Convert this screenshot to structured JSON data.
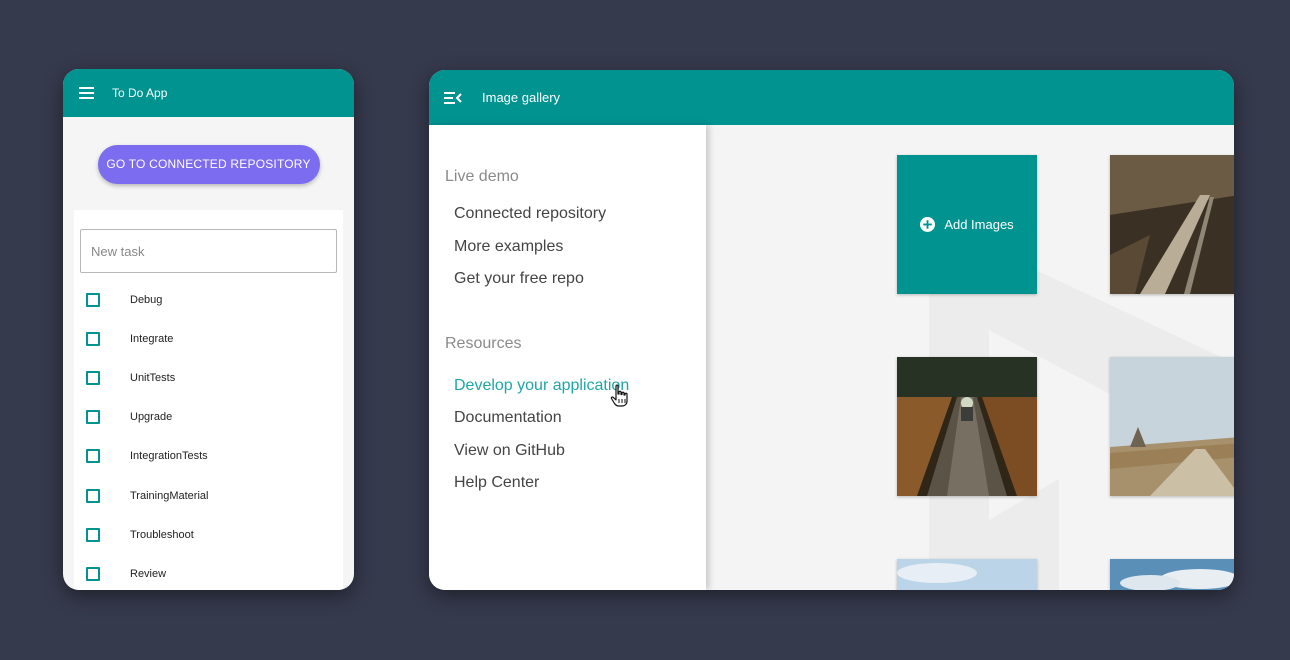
{
  "todo_app": {
    "title": "To Do App",
    "cta_label": "GO TO CONNECTED REPOSITORY",
    "new_task_placeholder": "New task",
    "tasks": [
      {
        "label": "Debug",
        "checked": false
      },
      {
        "label": "Integrate",
        "checked": false
      },
      {
        "label": "UnitTests",
        "checked": false
      },
      {
        "label": "Upgrade",
        "checked": false
      },
      {
        "label": "IntegrationTests",
        "checked": false
      },
      {
        "label": "TrainingMaterial",
        "checked": false
      },
      {
        "label": "Troubleshoot",
        "checked": false
      },
      {
        "label": "Review",
        "checked": false
      }
    ]
  },
  "gallery": {
    "title": "Image gallery",
    "drawer": {
      "live_demo_header": "Live demo",
      "live_demo_items": [
        "Connected repository",
        "More examples",
        "Get your free repo"
      ],
      "resources_header": "Resources",
      "resources_items": [
        "Develop your application",
        "Documentation",
        "View on GitHub",
        "Help Center"
      ],
      "active_item": "Develop your application"
    },
    "add_images_label": "Add Images"
  },
  "colors": {
    "teal": "#009390",
    "purple_button": "#7b6cf0",
    "active_link": "#20a6a6",
    "background": "#363a4d"
  },
  "icons": {
    "todo_menu": "hamburger-menu-icon",
    "gallery_menu": "menu-open-icon",
    "add": "plus-circle-icon",
    "cursor": "hand-pointer-icon"
  }
}
